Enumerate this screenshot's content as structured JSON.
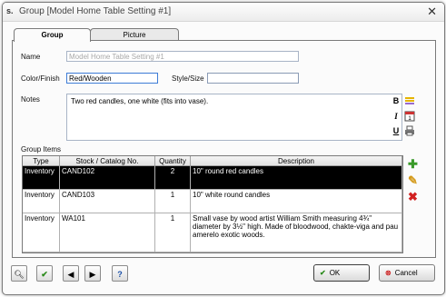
{
  "window": {
    "title": "Group [Model Home Table Setting #1]",
    "app_icon_text": "s."
  },
  "tabs": [
    {
      "label": "Group"
    },
    {
      "label": "Picture"
    }
  ],
  "form": {
    "name_label": "Name",
    "name_value": "Model Home Table Setting #1",
    "color_label": "Color/Finish",
    "color_value": "Red/Wooden",
    "style_label": "Style/Size",
    "style_value": "",
    "notes_label": "Notes",
    "notes_value": "Two red candles, one white (fits into vase)."
  },
  "group_items": {
    "label": "Group Items",
    "columns": [
      "Type",
      "Stock / Catalog No.",
      "Quantity",
      "Description"
    ],
    "rows": [
      {
        "type": "Inventory",
        "stock": "CAND102",
        "qty": "2",
        "desc": "10\" round red candles"
      },
      {
        "type": "Inventory",
        "stock": "CAND103",
        "qty": "1",
        "desc": "10\" white round candles"
      },
      {
        "type": "Inventory",
        "stock": "WA101",
        "qty": "1",
        "desc": "Small vase by wood artist William Smith measuring 4¾\" diameter by 3½\" high. Made of bloodwood, chakte-viga and pau amerelo exotic woods."
      }
    ]
  },
  "buttons": {
    "ok": "OK",
    "cancel": "Cancel"
  },
  "colors": {
    "selected_row": "#000000",
    "add_green": "#3a9a2a",
    "delete_red": "#d22020",
    "ok_check": "#2a8a1a",
    "cancel_red": "#cc2222"
  }
}
